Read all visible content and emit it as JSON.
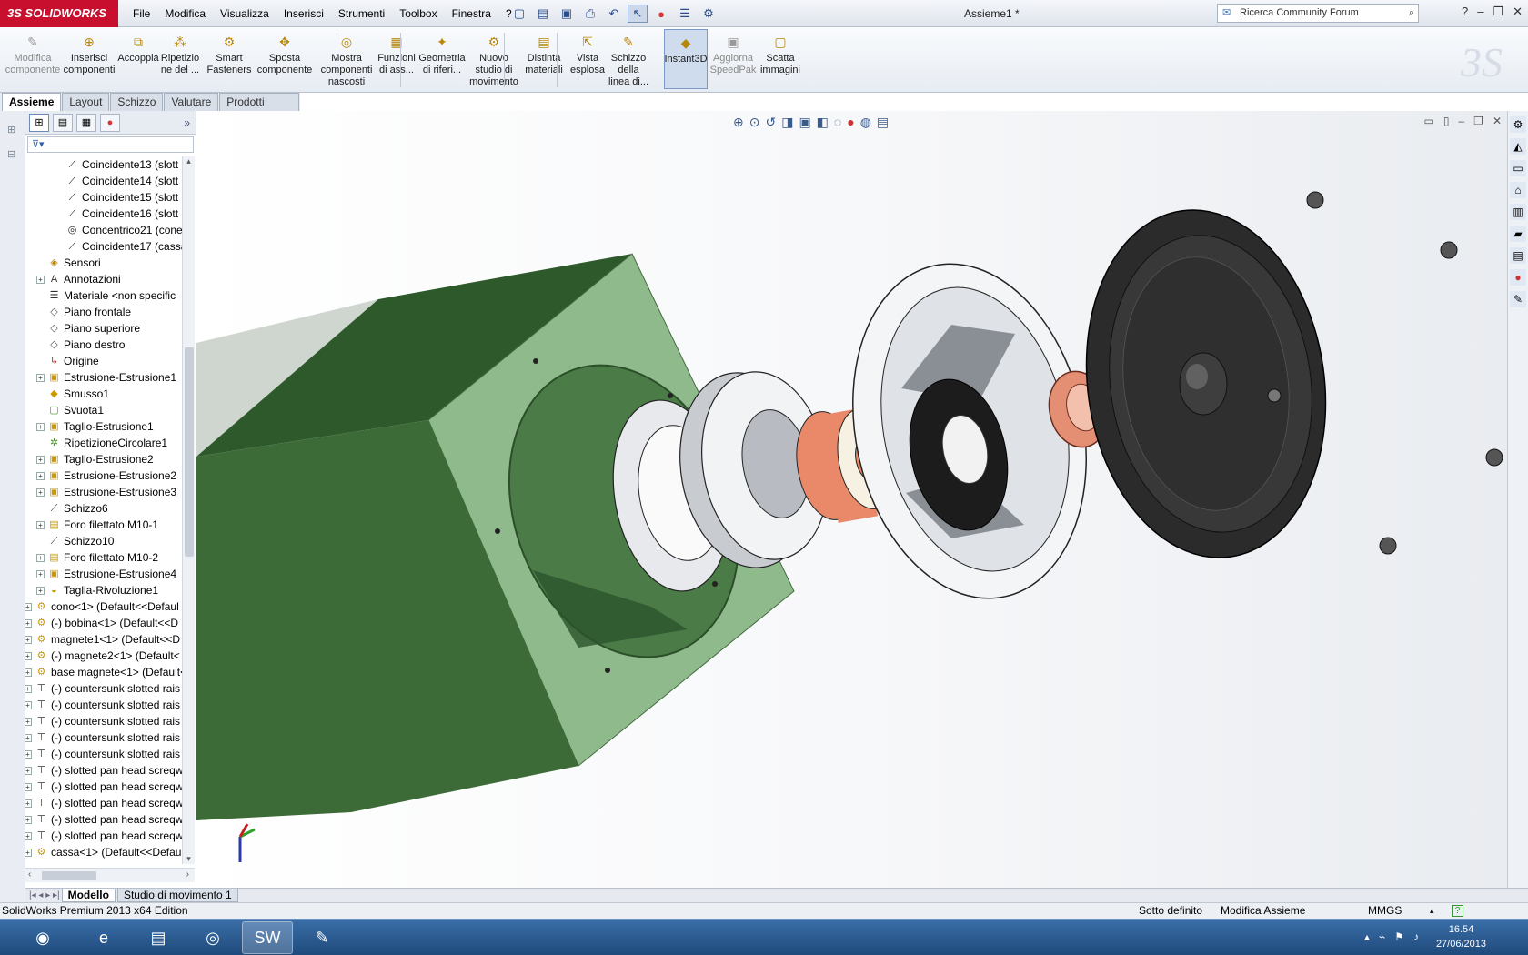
{
  "app": {
    "logo_prefix": "3S",
    "logo_name": "SOLIDWORKS",
    "document_title": "Assieme1 *"
  },
  "menu": [
    "File",
    "Modifica",
    "Visualizza",
    "Inserisci",
    "Strumenti",
    "Toolbox",
    "Finestra",
    "?"
  ],
  "search": {
    "placeholder": "Ricerca Community Forum"
  },
  "ribbon": [
    {
      "label": "Modifica\ncomponente",
      "icon": "edit-component-icon",
      "disabled": true
    },
    {
      "label": "Inserisci\ncomponenti",
      "icon": "insert-components-icon"
    },
    {
      "label": "Accoppia",
      "icon": "mate-icon"
    },
    {
      "label": "Ripetizio\nne del ...",
      "icon": "pattern-icon"
    },
    {
      "label": "Smart\nFasteners",
      "icon": "smart-fasteners-icon"
    },
    {
      "label": "Sposta\ncomponente",
      "icon": "move-component-icon"
    },
    {
      "label": "Mostra\ncomponenti\nnascosti",
      "icon": "show-hidden-icon"
    },
    {
      "label": "Funzioni\ndi ass...",
      "icon": "assembly-features-icon"
    },
    {
      "label": "Geometria\ndi riferi...",
      "icon": "reference-geometry-icon"
    },
    {
      "label": "Nuovo\nstudio di\nmovimento",
      "icon": "motion-study-icon"
    },
    {
      "label": "Distinta\nmateriali",
      "icon": "bom-icon"
    },
    {
      "label": "Vista\nesplosa",
      "icon": "exploded-view-icon"
    },
    {
      "label": "Schizzo\ndella\nlinea di...",
      "icon": "explode-line-sketch-icon"
    },
    {
      "label": "Instant3D",
      "icon": "instant3d-icon",
      "active": true
    },
    {
      "label": "Aggiorna\nSpeedPak",
      "icon": "speedpak-icon",
      "disabled": true
    },
    {
      "label": "Scatta\nimmagini",
      "icon": "snapshot-icon"
    }
  ],
  "command_tabs": [
    "Assieme",
    "Layout",
    "Schizzo",
    "Valutare",
    "Prodotti Office"
  ],
  "tree": [
    {
      "label": "Coincidente13 (slott",
      "icon": "mate",
      "level": 3
    },
    {
      "label": "Coincidente14 (slott",
      "icon": "mate",
      "level": 3
    },
    {
      "label": "Coincidente15 (slott",
      "icon": "mate",
      "level": 3
    },
    {
      "label": "Coincidente16 (slott",
      "icon": "mate",
      "level": 3
    },
    {
      "label": "Concentrico21 (cone",
      "icon": "concentric",
      "level": 3
    },
    {
      "label": "Coincidente17 (cassa",
      "icon": "mate",
      "level": 3
    },
    {
      "label": "Sensori",
      "icon": "sensor",
      "level": 2
    },
    {
      "label": "Annotazioni",
      "icon": "annotation",
      "level": 2,
      "expander": true
    },
    {
      "label": "Materiale <non specific",
      "icon": "material",
      "level": 2
    },
    {
      "label": "Piano frontale",
      "icon": "plane",
      "level": 2
    },
    {
      "label": "Piano superiore",
      "icon": "plane",
      "level": 2
    },
    {
      "label": "Piano destro",
      "icon": "plane",
      "level": 2
    },
    {
      "label": "Origine",
      "icon": "origin",
      "level": 2
    },
    {
      "label": "Estrusione-Estrusione1",
      "icon": "feature",
      "level": 2,
      "expander": true
    },
    {
      "label": "Smusso1",
      "icon": "chamfer",
      "level": 2
    },
    {
      "label": "Svuota1",
      "icon": "shell",
      "level": 2
    },
    {
      "label": "Taglio-Estrusione1",
      "icon": "feature",
      "level": 2,
      "expander": true
    },
    {
      "label": "RipetizioneCircolare1",
      "icon": "pattern",
      "level": 2
    },
    {
      "label": "Taglio-Estrusione2",
      "icon": "feature",
      "level": 2,
      "expander": true
    },
    {
      "label": "Estrusione-Estrusione2",
      "icon": "feature",
      "level": 2,
      "expander": true
    },
    {
      "label": "Estrusione-Estrusione3",
      "icon": "feature",
      "level": 2,
      "expander": true
    },
    {
      "label": "Schizzo6",
      "icon": "sketch",
      "level": 2
    },
    {
      "label": "Foro filettato M10-1",
      "icon": "hole",
      "level": 2,
      "expander": true
    },
    {
      "label": "Schizzo10",
      "icon": "sketch",
      "level": 2
    },
    {
      "label": "Foro filettato M10-2",
      "icon": "hole",
      "level": 2,
      "expander": true
    },
    {
      "label": "Estrusione-Estrusione4",
      "icon": "feature",
      "level": 2,
      "expander": true
    },
    {
      "label": "Taglia-Rivoluzione1",
      "icon": "revolve",
      "level": 2,
      "expander": true
    },
    {
      "label": "cono<1> (Default<<Defaul",
      "icon": "part",
      "level": 1,
      "expander": true
    },
    {
      "label": "(-) bobina<1> (Default<<D",
      "icon": "part",
      "level": 1,
      "expander": true
    },
    {
      "label": "magnete1<1> (Default<<D",
      "icon": "part",
      "level": 1,
      "expander": true
    },
    {
      "label": "(-) magnete2<1> (Default<",
      "icon": "part",
      "level": 1,
      "expander": true
    },
    {
      "label": "base magnete<1> (Default<",
      "icon": "part",
      "level": 1,
      "expander": true
    },
    {
      "label": "(-) countersunk slotted rais",
      "icon": "screw",
      "level": 1,
      "expander": true
    },
    {
      "label": "(-) countersunk slotted rais",
      "icon": "screw",
      "level": 1,
      "expander": true
    },
    {
      "label": "(-) countersunk slotted rais",
      "icon": "screw",
      "level": 1,
      "expander": true
    },
    {
      "label": "(-) countersunk slotted rais",
      "icon": "screw",
      "level": 1,
      "expander": true
    },
    {
      "label": "(-) countersunk slotted rais",
      "icon": "screw",
      "level": 1,
      "expander": true
    },
    {
      "label": "(-) slotted pan head screqw",
      "icon": "screw",
      "level": 1,
      "expander": true
    },
    {
      "label": "(-) slotted pan head screqw",
      "icon": "screw",
      "level": 1,
      "expander": true
    },
    {
      "label": "(-) slotted pan head screqw",
      "icon": "screw",
      "level": 1,
      "expander": true
    },
    {
      "label": "(-) slotted pan head screqw",
      "icon": "screw",
      "level": 1,
      "expander": true
    },
    {
      "label": "(-) slotted pan head screqw",
      "icon": "screw",
      "level": 1,
      "expander": true
    },
    {
      "label": "cassa<1> (Default<<Defaul",
      "icon": "part",
      "level": 1,
      "expander": true
    }
  ],
  "bottom_tabs": [
    "Modello",
    "Studio di movimento 1"
  ],
  "status": {
    "edition": "SolidWorks Premium 2013 x64 Edition",
    "definition": "Sotto definito",
    "mode": "Modifica Assieme",
    "units": "MMGS"
  },
  "clock": {
    "time": "16.54",
    "date": "27/06/2013"
  },
  "colors": {
    "box": "#8fb98b",
    "box_dark": "#2f5a2b",
    "ring": "#f1f2f4",
    "coil": "#e98a68",
    "speaker": "#2a2a2a",
    "accent": "#c8102e"
  }
}
